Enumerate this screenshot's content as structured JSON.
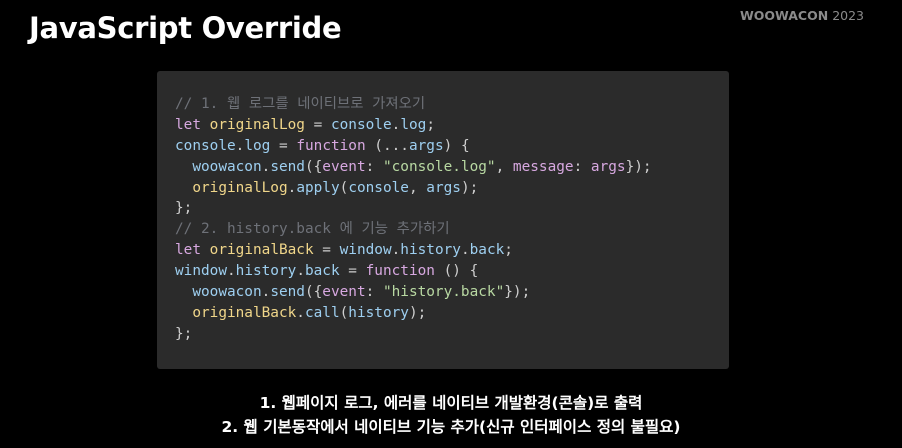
{
  "slide": {
    "title": "JavaScript Override",
    "brand": {
      "name": "WOOWACON",
      "year": "2023"
    },
    "colors": {
      "background": "#000000",
      "code_panel": "#2b2b2b",
      "comment": "#6e7178",
      "keyword": "#d7a8e0",
      "identifier": "#9ecff0",
      "string": "#b8d8a2",
      "highlight_identifier": "#f0d68a"
    },
    "code_lines": [
      [
        {
          "t": "cm",
          "v": "// 1. 웹 로그를 네이티브로 가져오기"
        }
      ],
      [
        {
          "t": "kw",
          "v": "let"
        },
        {
          "t": "pu",
          "v": " "
        },
        {
          "t": "id",
          "v": "originalLog"
        },
        {
          "t": "pu",
          "v": " = "
        },
        {
          "t": "id",
          "v": "console"
        },
        {
          "t": "pu",
          "v": "."
        },
        {
          "t": "pr",
          "v": "log"
        },
        {
          "t": "pu",
          "v": ";"
        }
      ],
      [
        {
          "t": "id",
          "v": "console"
        },
        {
          "t": "pu",
          "v": "."
        },
        {
          "t": "pr",
          "v": "log"
        },
        {
          "t": "pu",
          "v": " = "
        },
        {
          "t": "kw",
          "v": "function"
        },
        {
          "t": "pu",
          "v": " (..."
        },
        {
          "t": "id",
          "v": "args"
        },
        {
          "t": "pu",
          "v": ") {"
        }
      ],
      [
        {
          "t": "pu",
          "v": "  "
        },
        {
          "t": "id",
          "v": "woowacon"
        },
        {
          "t": "pu",
          "v": "."
        },
        {
          "t": "fn",
          "v": "send"
        },
        {
          "t": "pu",
          "v": "({"
        },
        {
          "t": "kw",
          "v": "event"
        },
        {
          "t": "pu",
          "v": ": "
        },
        {
          "t": "str",
          "v": "\"console.log\""
        },
        {
          "t": "pu",
          "v": ", "
        },
        {
          "t": "kw",
          "v": "message"
        },
        {
          "t": "pu",
          "v": ": "
        },
        {
          "t": "kw",
          "v": "args"
        },
        {
          "t": "pu",
          "v": "});"
        }
      ],
      [
        {
          "t": "pu",
          "v": "  "
        },
        {
          "t": "id",
          "v": "originalLog"
        },
        {
          "t": "pu",
          "v": "."
        },
        {
          "t": "fn",
          "v": "apply"
        },
        {
          "t": "pu",
          "v": "("
        },
        {
          "t": "id",
          "v": "console"
        },
        {
          "t": "pu",
          "v": ", "
        },
        {
          "t": "id",
          "v": "args"
        },
        {
          "t": "pu",
          "v": ");"
        }
      ],
      [
        {
          "t": "pu",
          "v": "};"
        }
      ],
      [
        {
          "t": "cm",
          "v": "// 2. history.back 에 기능 추가하기"
        }
      ],
      [
        {
          "t": "kw",
          "v": "let"
        },
        {
          "t": "pu",
          "v": " "
        },
        {
          "t": "id",
          "v": "originalBack"
        },
        {
          "t": "pu",
          "v": " = "
        },
        {
          "t": "id",
          "v": "window"
        },
        {
          "t": "pu",
          "v": "."
        },
        {
          "t": "id",
          "v": "history"
        },
        {
          "t": "pu",
          "v": "."
        },
        {
          "t": "pr",
          "v": "back"
        },
        {
          "t": "pu",
          "v": ";"
        }
      ],
      [
        {
          "t": "id",
          "v": "window"
        },
        {
          "t": "pu",
          "v": "."
        },
        {
          "t": "id",
          "v": "history"
        },
        {
          "t": "pu",
          "v": "."
        },
        {
          "t": "pr",
          "v": "back"
        },
        {
          "t": "pu",
          "v": " = "
        },
        {
          "t": "kw",
          "v": "function"
        },
        {
          "t": "pu",
          "v": " () {"
        }
      ],
      [
        {
          "t": "pu",
          "v": "  "
        },
        {
          "t": "id",
          "v": "woowacon"
        },
        {
          "t": "pu",
          "v": "."
        },
        {
          "t": "fn",
          "v": "send"
        },
        {
          "t": "pu",
          "v": "({"
        },
        {
          "t": "kw",
          "v": "event"
        },
        {
          "t": "pu",
          "v": ": "
        },
        {
          "t": "str",
          "v": "\"history.back\""
        },
        {
          "t": "pu",
          "v": "});"
        }
      ],
      [
        {
          "t": "pu",
          "v": "  "
        },
        {
          "t": "id",
          "v": "originalBack"
        },
        {
          "t": "pu",
          "v": "."
        },
        {
          "t": "fn",
          "v": "call"
        },
        {
          "t": "pu",
          "v": "("
        },
        {
          "t": "id",
          "v": "history"
        },
        {
          "t": "pu",
          "v": ");"
        }
      ],
      [
        {
          "t": "pu",
          "v": "};"
        }
      ]
    ],
    "captions": [
      "1. 웹페이지 로그, 에러를 네이티브 개발환경(콘솔)로 출력",
      "2. 웹 기본동작에서 네이티브 기능 추가(신규 인터페이스 정의 불필요)"
    ]
  }
}
